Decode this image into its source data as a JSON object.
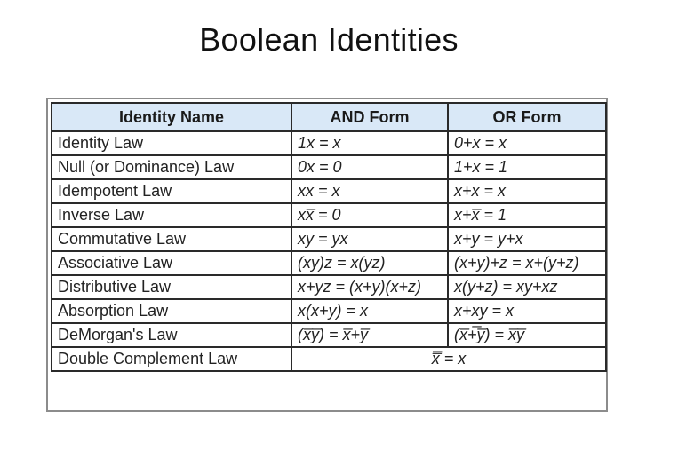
{
  "slide": {
    "title": "Boolean Identities"
  },
  "table": {
    "headers": [
      "Identity Name",
      "AND Form",
      "OR Form"
    ],
    "rows": [
      {
        "name": "Identity Law",
        "and": "1x = x",
        "or": "0+x = x"
      },
      {
        "name": "Null (or Dominance) Law",
        "and": "0x = 0",
        "or": "1+x = 1"
      },
      {
        "name": "Idempotent Law",
        "and": "xx = x",
        "or": "x+x = x"
      },
      {
        "name": "Inverse Law",
        "and": "xx̅ = 0",
        "or": "x+x̅ = 1"
      },
      {
        "name": "Commutative Law",
        "and": "xy = yx",
        "or": "x+y = y+x"
      },
      {
        "name": "Associative Law",
        "and": "(xy)z = x(yz)",
        "or": "(x+y)+z = x+(y+z)"
      },
      {
        "name": "Distributive Law",
        "and": "x+yz = (x+y)(x+z)",
        "or": "x(y+z) = xy+xz"
      },
      {
        "name": "Absorption Law",
        "and": "x(x+y) = x",
        "or": "x+xy = x"
      },
      {
        "name": "DeMorgan's Law",
        "and": "(x̅y̅) = x̅+y̅",
        "or": "(x̅+̅y̅) = x̅y̅"
      },
      {
        "name": "Double Complement Law",
        "merged": "x̿ = x"
      }
    ]
  }
}
